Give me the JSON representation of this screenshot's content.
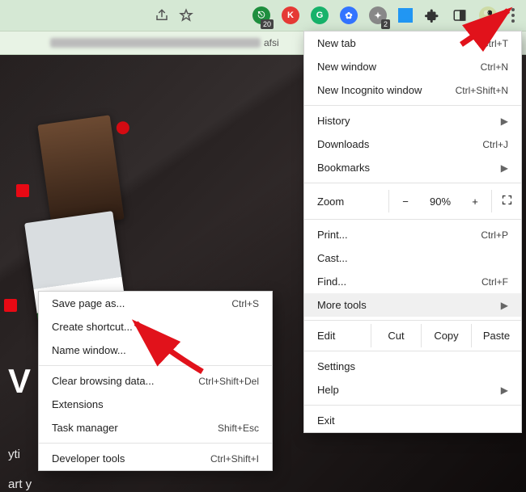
{
  "toolbar": {
    "badge20": "20",
    "badge2": "2"
  },
  "url_tail": "afsi",
  "main_menu": {
    "new_tab": "New tab",
    "new_tab_sc": "Ctrl+T",
    "new_window": "New window",
    "new_window_sc": "Ctrl+N",
    "incognito": "New Incognito window",
    "incognito_sc": "Ctrl+Shift+N",
    "history": "History",
    "downloads": "Downloads",
    "downloads_sc": "Ctrl+J",
    "bookmarks": "Bookmarks",
    "zoom_label": "Zoom",
    "zoom_pct": "90%",
    "print": "Print...",
    "print_sc": "Ctrl+P",
    "cast": "Cast...",
    "find": "Find...",
    "find_sc": "Ctrl+F",
    "more_tools": "More tools",
    "edit": "Edit",
    "cut": "Cut",
    "copy": "Copy",
    "paste": "Paste",
    "settings": "Settings",
    "help": "Help",
    "exit": "Exit"
  },
  "sub_menu": {
    "save_as": "Save page as...",
    "save_as_sc": "Ctrl+S",
    "create_shortcut": "Create shortcut...",
    "name_window": "Name window...",
    "clear_data": "Clear browsing data...",
    "clear_data_sc": "Ctrl+Shift+Del",
    "extensions": "Extensions",
    "task_manager": "Task manager",
    "task_manager_sc": "Shift+Esc",
    "dev_tools": "Developer tools",
    "dev_tools_sc": "Ctrl+Shift+I"
  },
  "hero": {
    "title_fragment": "V",
    "line1_prefix": "yti",
    "line2_prefix": "art y"
  }
}
